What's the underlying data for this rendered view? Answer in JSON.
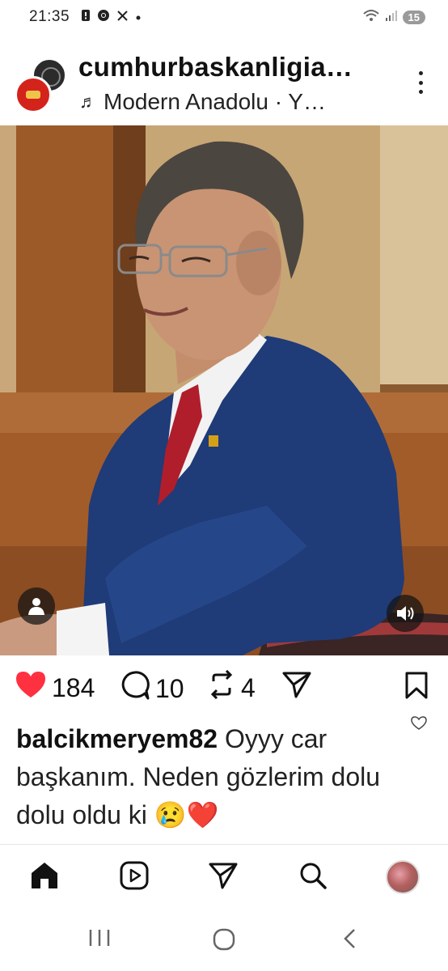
{
  "status_bar": {
    "time": "21:35",
    "battery": "15",
    "left_icons": [
      "alert-icon",
      "chrome-icon",
      "x-icon",
      "dot-icon"
    ],
    "right_icons": [
      "wifi-icon",
      "signal-icon",
      "battery-icon"
    ]
  },
  "post": {
    "account_name": "cumhurbaskanligia…",
    "audio": "Modern Anadolu · Y…"
  },
  "actions": {
    "likes": "184",
    "comments": "10",
    "reposts": "4"
  },
  "comment": {
    "username": "balcikmeryem82",
    "text": " Oyyy car başkanım. Neden gözlerim dolu dolu oldu ki 😢❤️"
  },
  "colors": {
    "like_red": "#ff3040",
    "text": "#111111",
    "divider": "#e6e6e6"
  },
  "bottom_nav": [
    "home-icon",
    "reels-icon",
    "direct-icon",
    "search-icon",
    "profile-avatar"
  ],
  "system_nav": [
    "recents-icon",
    "home-circle-icon",
    "back-icon"
  ]
}
